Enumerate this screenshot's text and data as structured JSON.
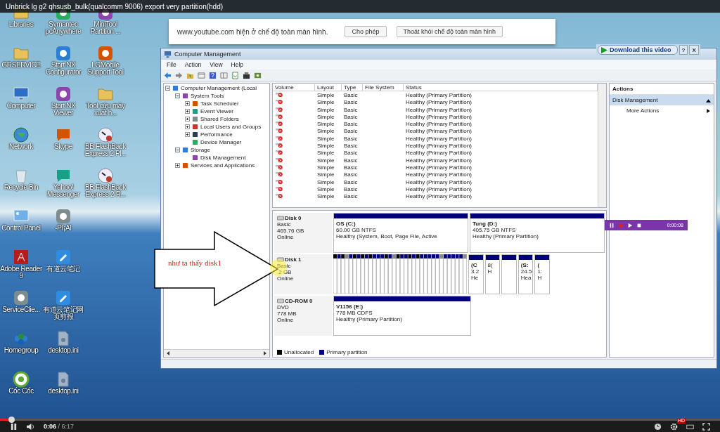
{
  "video_title": "Unbrick lg g2 qhsusb_bulk(qualcomm 9006) export very partition(hdd)",
  "desktop_icons": [
    {
      "label": "Libraries",
      "kind": "folder"
    },
    {
      "label": "GRSERVICE",
      "kind": "folder"
    },
    {
      "label": "Computer",
      "kind": "computer"
    },
    {
      "label": "Network",
      "kind": "globe"
    },
    {
      "label": "Recycle Bin",
      "kind": "bin"
    },
    {
      "label": "Control Panel",
      "kind": "panel"
    },
    {
      "label": "Adobe Reader 9",
      "kind": "pdf"
    },
    {
      "label": "ServiceClie...",
      "kind": "app"
    },
    {
      "label": "Homegroup",
      "kind": "spheres"
    },
    {
      "label": "Cốc Cốc",
      "kind": "browser"
    },
    {
      "label": "Symantec pcAnywhere",
      "kind": "app"
    },
    {
      "label": "Start NX Configurator",
      "kind": "app"
    },
    {
      "label": "Start NX Viewer",
      "kind": "app"
    },
    {
      "label": "Skype",
      "kind": "chat"
    },
    {
      "label": "Yahoo! Messenger",
      "kind": "chat"
    },
    {
      "label": "-PI¡AI",
      "kind": "app"
    },
    {
      "label": "有道云笔记",
      "kind": "note"
    },
    {
      "label": "有道云笔记网页剪报",
      "kind": "note"
    },
    {
      "label": "desktop.ini",
      "kind": "file"
    },
    {
      "label": "desktop.ini",
      "kind": "file"
    },
    {
      "label": "MiniTool Partition ...",
      "kind": "app"
    },
    {
      "label": "LGMobile Support Tool",
      "kind": "app"
    },
    {
      "label": "Tool cứu máy xuất h...",
      "kind": "folder"
    },
    {
      "label": "BB FlashBack Express 2 Pl...",
      "kind": "gauge"
    },
    {
      "label": "BB FlashBack Express 2 R...",
      "kind": "gauge"
    }
  ],
  "fullscreen_notice": {
    "message": "www.youtube.com hiện ở chế độ toàn màn hình.",
    "buttons": [
      "Cho phép",
      "Thoát khỏi chế độ toàn màn hình"
    ]
  },
  "download_bar": {
    "label": "Download this video",
    "help": "?",
    "close": "X"
  },
  "window": {
    "title": "Computer Management",
    "menu": [
      "File",
      "Action",
      "View",
      "Help"
    ],
    "tree": [
      {
        "label": "Computer Management (Local",
        "expanded": true,
        "children": [
          {
            "label": "System Tools",
            "expanded": true,
            "children": [
              {
                "label": "Task Scheduler",
                "expanded": false
              },
              {
                "label": "Event Viewer",
                "expanded": false
              },
              {
                "label": "Shared Folders",
                "expanded": false
              },
              {
                "label": "Local Users and Groups",
                "expanded": false
              },
              {
                "label": "Performance",
                "expanded": false
              },
              {
                "label": "Device Manager"
              }
            ]
          },
          {
            "label": "Storage",
            "expanded": true,
            "children": [
              {
                "label": "Disk Management"
              }
            ]
          },
          {
            "label": "Services and Applications",
            "expanded": false
          }
        ]
      }
    ],
    "volume_table": {
      "columns": [
        "Volume",
        "Layout",
        "Type",
        "File System",
        "Status"
      ],
      "rows": [
        {
          "layout": "Simple",
          "type": "Basic",
          "status": "Healthy (Primary Partition)"
        },
        {
          "layout": "Simple",
          "type": "Basic",
          "status": "Healthy (Primary Partition)"
        },
        {
          "layout": "Simple",
          "type": "Basic",
          "status": "Healthy (Primary Partition)"
        },
        {
          "layout": "Simple",
          "type": "Basic",
          "status": "Healthy (Primary Partition)"
        },
        {
          "layout": "Simple",
          "type": "Basic",
          "status": "Healthy (Primary Partition)"
        },
        {
          "layout": "Simple",
          "type": "Basic",
          "status": "Healthy (Primary Partition)"
        },
        {
          "layout": "Simple",
          "type": "Basic",
          "status": "Healthy (Primary Partition)"
        },
        {
          "layout": "Simple",
          "type": "Basic",
          "status": "Healthy (Primary Partition)"
        },
        {
          "layout": "Simple",
          "type": "Basic",
          "status": "Healthy (Primary Partition)"
        },
        {
          "layout": "Simple",
          "type": "Basic",
          "status": "Healthy (Primary Partition)"
        },
        {
          "layout": "Simple",
          "type": "Basic",
          "status": "Healthy (Primary Partition)"
        },
        {
          "layout": "Simple",
          "type": "Basic",
          "status": "Healthy (Primary Partition)"
        },
        {
          "layout": "Simple",
          "type": "Basic",
          "status": "Healthy (Primary Partition)"
        },
        {
          "layout": "Simple",
          "type": "Basic",
          "status": "Healthy (Primary Partition)"
        },
        {
          "layout": "Simple",
          "type": "Basic",
          "status": "Healthy (Primary Partition)"
        }
      ]
    },
    "disks": [
      {
        "name": "Disk 0",
        "kind": "basic",
        "lines": [
          "Basic",
          "465.76 GB",
          "Online"
        ],
        "partitions": [
          {
            "kind": "primary",
            "title": "OS  (C:)",
            "lines": [
              "60.00 GB NTFS",
              "Healthy (System, Boot, Page File, Active"
            ]
          },
          {
            "kind": "primary",
            "title": "Tung  (D:)",
            "lines": [
              "405.75 GB NTFS",
              "Healthy (Primary Partition)"
            ]
          }
        ]
      },
      {
        "name": "Disk 1",
        "kind": "striped",
        "lines": [
          "Basic",
          ".2 GB",
          "Online"
        ],
        "partitions": [
          {
            "kind": "primary",
            "title": "(C",
            "lines": [
              "3.2",
              "He"
            ]
          },
          {
            "kind": "primary",
            "lines": [
              "8(",
              "H"
            ]
          },
          {
            "kind": "primary"
          },
          {
            "kind": "primary",
            "title": "(S:",
            "lines": [
              "24.5",
              "Hea"
            ]
          },
          {
            "kind": "primary",
            "title": "(",
            "lines": [
              "1:",
              "H"
            ]
          }
        ]
      },
      {
        "name": "CD-ROM 0",
        "kind": "cdrom",
        "lines": [
          "DVD",
          "778 MB",
          "Online"
        ],
        "partitions": [
          {
            "kind": "primary",
            "title": "V1156  (E:)",
            "lines": [
              "778 MB CDFS",
              "Healthy (Primary Partition)"
            ]
          }
        ]
      }
    ],
    "legend": [
      {
        "label": "Unallocated",
        "kind": "unallocated"
      },
      {
        "label": "Primary partition",
        "kind": "primary"
      }
    ],
    "actions": {
      "title": "Actions",
      "section": "Disk Management",
      "items": [
        "More Actions"
      ]
    }
  },
  "annotation": "như ta thấy disk1",
  "recorder": {
    "time": "0:00:08"
  },
  "player": {
    "level": 0.016,
    "time": "**0:06** / 6:17",
    "quality": "HD"
  }
}
